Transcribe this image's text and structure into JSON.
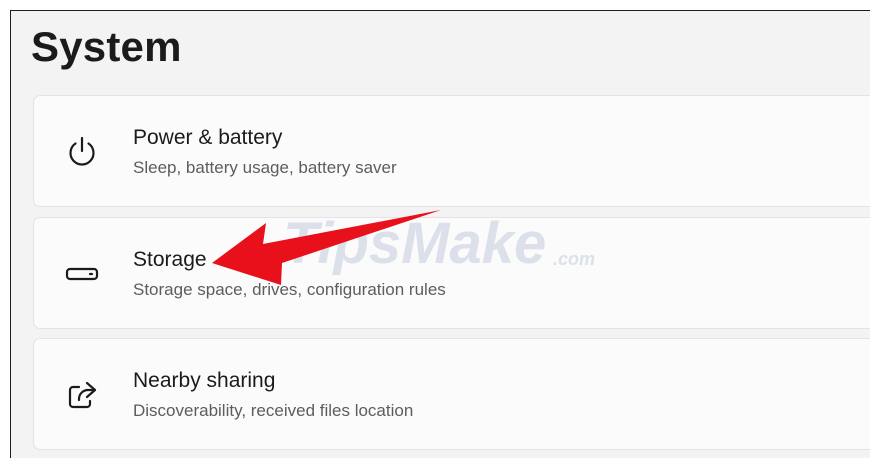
{
  "page": {
    "title": "System"
  },
  "items": [
    {
      "title": "Power & battery",
      "description": "Sleep, battery usage, battery saver",
      "icon": "power-icon"
    },
    {
      "title": "Storage",
      "description": "Storage space, drives, configuration rules",
      "icon": "storage-drive-icon"
    },
    {
      "title": "Nearby sharing",
      "description": "Discoverability, received files location",
      "icon": "share-icon"
    }
  ],
  "watermark": {
    "brand": "TipsMake",
    "suffix": ".com"
  },
  "colors": {
    "background": "#f3f3f3",
    "card": "#fbfbfb",
    "card_border": "#e3e3e3",
    "title_text": "#1b1b1b",
    "description_text": "#5d5d5d",
    "annotation_arrow": "#e8101a"
  }
}
